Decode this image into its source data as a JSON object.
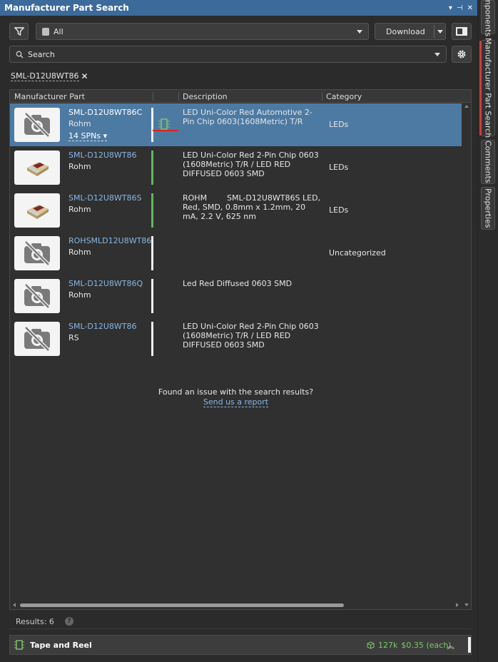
{
  "panel": {
    "title": "Manufacturer Part Search"
  },
  "toolbar": {
    "source_value": "All",
    "download_label": "Download"
  },
  "search": {
    "placeholder": "Search"
  },
  "filter_chip": {
    "text": "SML-D12U8WT86"
  },
  "table": {
    "columns": [
      "Manufacturer Part",
      "",
      "Description",
      "Category"
    ],
    "rows": [
      {
        "part": "SML-D12U8WT86C",
        "manufacturer": "Rohm",
        "spns": "14 SPNs",
        "description": "LED Uni-Color Red Automotive 2-Pin Chip 0603(1608Metric) T/R",
        "category": "LEDs",
        "bar_color": "#f0f0f0",
        "thumb": "no-image",
        "selected": true
      },
      {
        "part": "SML-D12U8WT86",
        "manufacturer": "Rohm",
        "spns": "",
        "description": "LED Uni-Color Red 2-Pin Chip 0603 (1608Metric) T/R / LED RED DIFFUSED 0603 SMD",
        "category": "LEDs",
        "bar_color": "#5cb85c",
        "thumb": "led-photo"
      },
      {
        "part": "SML-D12U8WT86S",
        "manufacturer": "Rohm",
        "spns": "",
        "description": "ROHM        SML-D12U8WT86S LED, Red, SMD, 0.8mm x 1.2mm, 20 mA, 2.2 V, 625 nm",
        "category": "LEDs",
        "bar_color": "#5cb85c",
        "thumb": "led-photo"
      },
      {
        "part": "ROHSMLD12U8WT86",
        "manufacturer": "Rohm",
        "spns": "",
        "description": "",
        "category": "Uncategorized",
        "bar_color": "#f0f0f0",
        "thumb": "no-image"
      },
      {
        "part": "SML-D12U8WT86Q",
        "manufacturer": "Rohm",
        "spns": "",
        "description": "Led Red Diffused 0603 SMD",
        "category": "",
        "bar_color": "#f0f0f0",
        "thumb": "no-image"
      },
      {
        "part": "SML-D12U8WT86",
        "manufacturer": "RS",
        "spns": "",
        "description": "LED Uni-Color Red 2-Pin Chip 0603 (1608Metric) T/R / LED RED DIFFUSED 0603 SMD",
        "category": "",
        "bar_color": "#f0f0f0",
        "thumb": "no-image"
      }
    ],
    "issue_text": "Found an issue with the search results?",
    "report_link": "Send us a report"
  },
  "status": {
    "results": "Results: 6"
  },
  "bottom": {
    "label": "Tape and Reel",
    "stock": "127k",
    "price": "$0.35 (each)",
    "accent": "#7cc86a"
  },
  "side_tabs": [
    "mponents",
    "Manufacturer Part Search",
    "Comments",
    "Properties"
  ]
}
